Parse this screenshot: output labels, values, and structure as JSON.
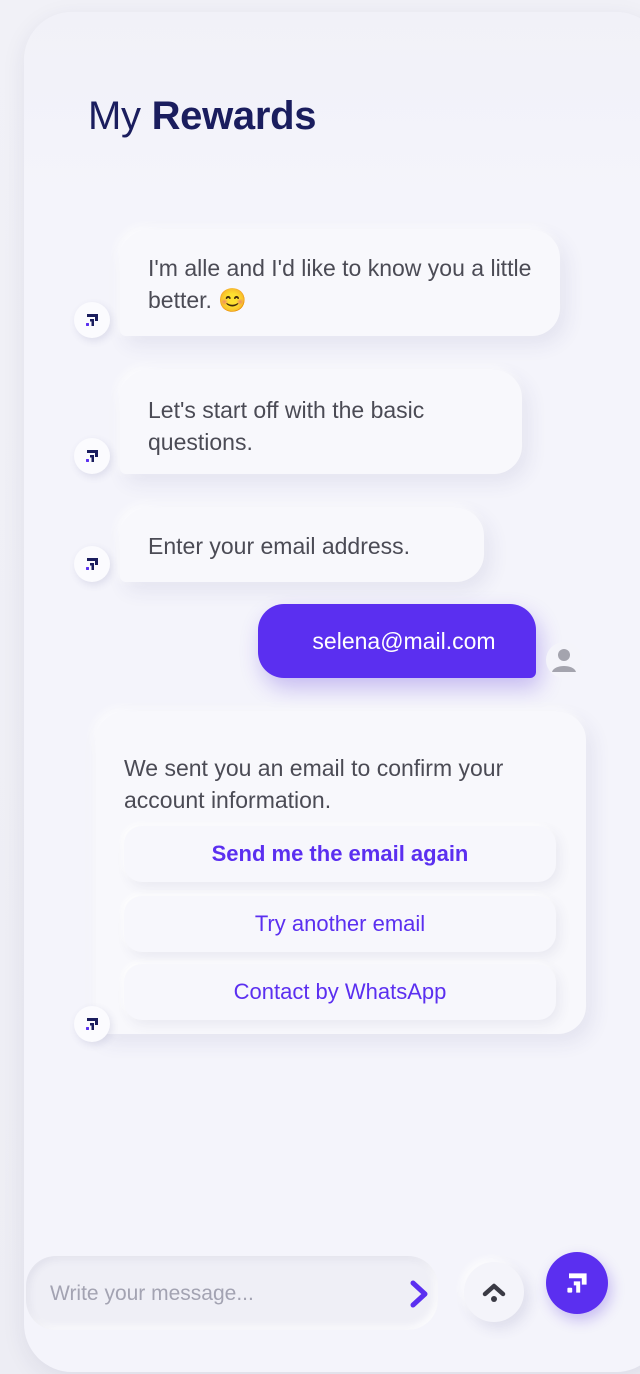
{
  "header": {
    "title_light": "My",
    "title_bold": "Rewards"
  },
  "messages": [
    {
      "from": "bot",
      "text": "I'm alle and I'd like to know you a little better. 😊"
    },
    {
      "from": "bot",
      "text": "Let's start off with the basic questions."
    },
    {
      "from": "bot",
      "text": "Enter your email address."
    },
    {
      "from": "user",
      "text": "selena@mail.com"
    },
    {
      "from": "bot",
      "text": "We sent you an email to confirm your account information.",
      "options": [
        {
          "label": "Send me the email again"
        },
        {
          "label": "Try another email"
        },
        {
          "label": "Contact by WhatsApp"
        }
      ]
    }
  ],
  "composer": {
    "placeholder": "Write your message..."
  },
  "icons": {
    "bot_avatar": "brand-logo-icon",
    "user_avatar": "user-icon",
    "send": "chevron-right-icon",
    "scroll_up": "chevron-up-icon",
    "brand_button": "brand-logo-icon"
  },
  "colors": {
    "accent": "#5b2ff0",
    "title": "#1a1d5e",
    "text": "#4b4b55",
    "background": "#f4f4fb"
  }
}
